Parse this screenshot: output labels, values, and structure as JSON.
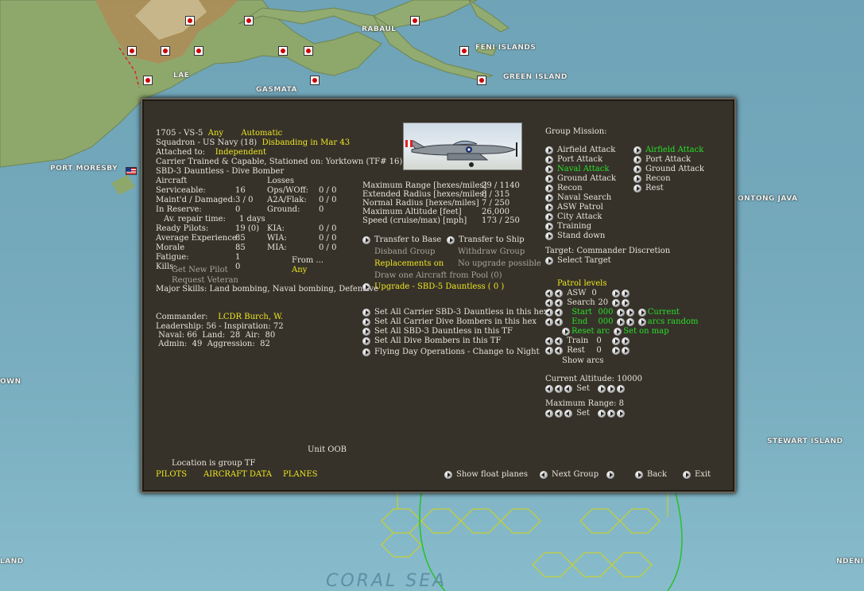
{
  "map": {
    "labels": [
      "RABAUL",
      "FENI ISLANDS",
      "LAE",
      "GREEN ISLAND",
      "GASMATA",
      "PORT MORESBY",
      "ONTONG JAVA",
      "OWN",
      "STEWART ISLAND",
      "LAND",
      "NDENI"
    ],
    "sea": "CORAL SEA"
  },
  "unit": {
    "id": "1705 - VS-5",
    "any": "Any",
    "automatic": "Automatic",
    "squadron": "Squadron - US Navy (18)",
    "disbanding": "Disbanding in Mar 43",
    "attached_label": "Attached to:",
    "attached": "Independent",
    "carrier_line": "Carrier Trained & Capable, Stationed on:  Yorktown (TF# 16)",
    "aircraft_type": "SBD-3 Dauntless - Dive Bomber"
  },
  "aircraft": {
    "header": "Aircraft",
    "rows": [
      {
        "label": "Serviceable:",
        "value": "16"
      },
      {
        "label": "Maint'd / Damaged:",
        "value": "3 / 0"
      },
      {
        "label": "In Reserve:",
        "value": "0"
      },
      {
        "label": "Av. repair time:",
        "value": "1 days"
      }
    ]
  },
  "losses": {
    "header": "Losses",
    "rows": [
      {
        "label": "Ops/WOff:",
        "value": "0 / 0"
      },
      {
        "label": "A2A/Flak:",
        "value": "0 / 0"
      },
      {
        "label": "Ground:",
        "value": "0"
      }
    ]
  },
  "pilots": {
    "rows": [
      {
        "label": "Ready Pilots:",
        "value": "19 (0)"
      },
      {
        "label": "Average Experience",
        "value": "85"
      },
      {
        "label": "Morale",
        "value": "85"
      },
      {
        "label": "Fatigue:",
        "value": "1"
      },
      {
        "label": "Kills:",
        "value": "0"
      }
    ],
    "casualties": [
      {
        "label": "KIA:",
        "value": "0 / 0"
      },
      {
        "label": "WIA:",
        "value": "0 / 0"
      },
      {
        "label": "MIA:",
        "value": "0 / 0"
      }
    ],
    "from_label": "From ...",
    "from_value": "Any",
    "get_new_pilot": "Get New Pilot",
    "request_veteran": "Request Veteran",
    "major_skills": "Major Skills:  Land bombing, Naval bombing, Defensive"
  },
  "commander": {
    "label": "Commander:",
    "name": "LCDR Burch, W.",
    "line1": "Leadership: 56 - Inspiration: 72",
    "line2": " Naval: 66  Land:  28  Air:  80",
    "line3": " Admin:  49  Aggression:  82"
  },
  "performance": [
    {
      "label": "Maximum Range [hexes/miles]",
      "value": "29 / 1140"
    },
    {
      "label": "Extended Radius [hexes/miles]",
      "value": "8 / 315"
    },
    {
      "label": "Normal Radius [hexes/miles]",
      "value": "7 / 250"
    },
    {
      "label": "Maximum Altitude [feet]",
      "value": "26,000"
    },
    {
      "label": "Speed (cruise/max) [mph]",
      "value": "173 / 250"
    }
  ],
  "actions": {
    "transfer_base": "Transfer to Base",
    "transfer_ship": "Transfer to Ship",
    "disband": "Disband Group",
    "withdraw": "Withdraw Group",
    "replacements": "Replacements on",
    "no_upgrade": "No upgrade possible",
    "draw_one": "Draw one Aircraft from Pool (0)",
    "upgrade": "Upgrade - SBD-5 Dauntless ( 0 )",
    "set_all": [
      "Set All Carrier SBD-3 Dauntless in this hex",
      "Set All Carrier Dive Bombers in this hex",
      "Set All SBD-3 Dauntless in this TF",
      "Set All Dive Bombers in this TF",
      "Flying Day Operations - Change to Night"
    ]
  },
  "mission": {
    "header": "Group Mission:",
    "col1": [
      "Airfield Attack",
      "Port Attack",
      "Naval Attack",
      "Ground Attack",
      "Recon",
      "Naval Search",
      "ASW Patrol",
      "City Attack",
      "Training",
      "Stand down"
    ],
    "col1_active": 2,
    "col2": [
      "Airfield Attack",
      "Port Attack",
      "Ground Attack",
      "Recon",
      "Rest"
    ],
    "col2_active": 0,
    "target": "Target: Commander Discretion",
    "select_target": "Select Target"
  },
  "patrol": {
    "header": "Patrol levels",
    "asw_label": "ASW",
    "asw_value": "0",
    "search_label": "Search",
    "search_value": "20",
    "start_label": "Start",
    "start_value": "000",
    "end_label": "End",
    "end_value": "000",
    "current": "Current",
    "arcs_random": "arcs random",
    "reset_arc": "Reset arc",
    "set_on_map": "Set on map",
    "train_label": "Train",
    "train_value": "0",
    "rest_label": "Rest",
    "rest_value": "0",
    "show_arcs": "Show arcs"
  },
  "altitude": {
    "label": "Current Altitude: 10000",
    "set": "Set"
  },
  "max_range": {
    "label": "Maximum Range: 8",
    "set": "Set"
  },
  "footer": {
    "unit_oob": "Unit OOB",
    "location": "Location is group TF",
    "pilots": "PILOTS",
    "aircraft_data": "AIRCRAFT DATA",
    "planes": "PLANES",
    "show_float": "Show float planes",
    "next_group": "Next Group",
    "back": "Back",
    "exit": "Exit"
  },
  "colors": {
    "panel": "#36322a",
    "yellow": "#f0e620",
    "green": "#28e028",
    "sea": "#74a8bb",
    "land": "#8ba56a"
  }
}
